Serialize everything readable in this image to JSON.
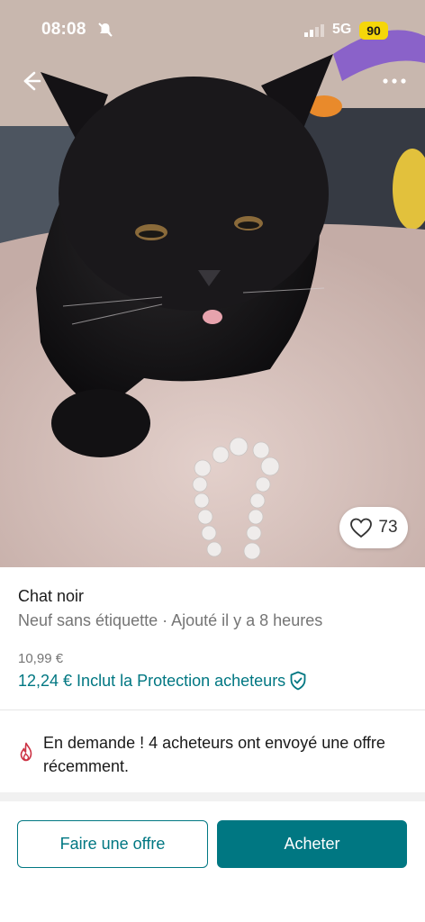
{
  "status_bar": {
    "time": "08:08",
    "network": "5G",
    "battery": "90",
    "battery_color": "#f5d60a"
  },
  "listing": {
    "title": "Chat noir",
    "meta": "Neuf sans étiquette · Ajouté il y a 8 heures",
    "price_base": "10,99 €",
    "price_with_protection": "12,24 € Inclut la Protection acheteurs",
    "likes": "73"
  },
  "demand_notice": "En demande ! 4 acheteurs ont envoyé une offre récemment.",
  "actions": {
    "offer_label": "Faire une offre",
    "buy_label": "Acheter"
  },
  "colors": {
    "accent": "#007782",
    "demand_icon": "#cc3344"
  },
  "icons": [
    "bell-slash-icon",
    "signal-icon",
    "back-arrow-icon",
    "more-dots-icon",
    "heart-icon",
    "shield-check-icon",
    "fire-icon"
  ]
}
